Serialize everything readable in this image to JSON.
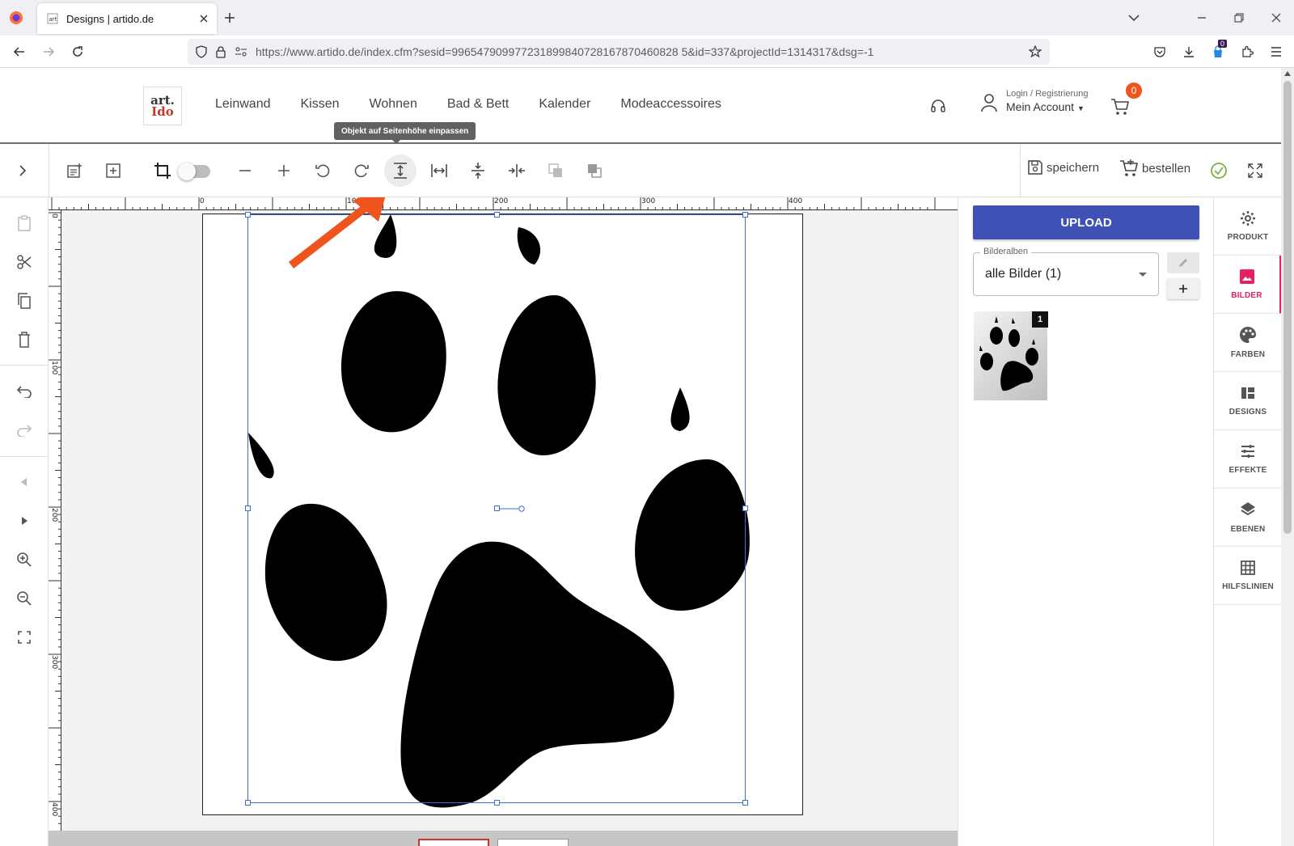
{
  "browser": {
    "tab_title": "Designs | artido.de",
    "url": "https://www.artido.de/index.cfm?sesid=996547909977231899840728167870460828 5&id=337&projectId=1314317&dsg=-1",
    "extension_badge": "0"
  },
  "site": {
    "logo_line1": "art.",
    "logo_line2": "Ido",
    "nav": [
      "Leinwand",
      "Kissen",
      "Wohnen",
      "Bad & Bett",
      "Kalender",
      "Modeaccessoires"
    ],
    "login_label": "Login / Registrierung",
    "account_label": "Mein Account",
    "cart_count": "0"
  },
  "tooltip": "Objekt auf Seitenhöhe einpassen",
  "toolbar": {
    "save_label": "speichern",
    "order_label": "bestellen"
  },
  "ruler": {
    "top": [
      "0",
      "100",
      "200",
      "300",
      "400"
    ],
    "left": [
      "0",
      "100",
      "200",
      "300",
      "400"
    ]
  },
  "right_panel": {
    "upload_label": "UPLOAD",
    "album_legend": "Bilderalben",
    "album_value": "alle Bilder (1)",
    "image_count_badge": "1"
  },
  "side_tabs": [
    {
      "label": "PRODUKT",
      "icon": "gear-icon"
    },
    {
      "label": "BILDER",
      "icon": "image-icon"
    },
    {
      "label": "FARBEN",
      "icon": "palette-icon"
    },
    {
      "label": "DESIGNS",
      "icon": "dashboard-icon"
    },
    {
      "label": "EFFEKTE",
      "icon": "tune-icon"
    },
    {
      "label": "EBENEN",
      "icon": "layers-icon"
    },
    {
      "label": "HILFSLINIEN",
      "icon": "grid-icon"
    }
  ],
  "colors": {
    "accent_blue": "#3f51b5",
    "active_pink": "#e91e63",
    "arrow_orange": "#f0541e",
    "selection_blue": "#3b6ed9"
  }
}
